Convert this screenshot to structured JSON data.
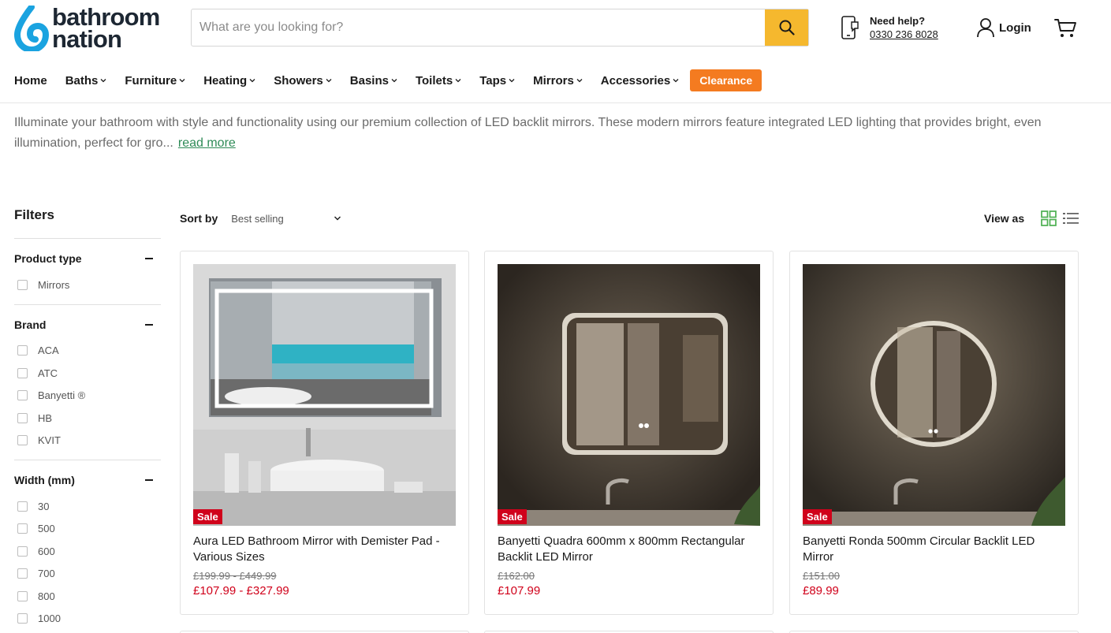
{
  "brand": {
    "line1": "bathroom",
    "line2": "nation",
    "logo_color": "#1aa3e0"
  },
  "search": {
    "placeholder": "What are you looking for?",
    "button_icon": "search-icon",
    "button_color": "#f5b82e"
  },
  "help": {
    "title": "Need help?",
    "phone": "0330 236 8028"
  },
  "account": {
    "login_label": "Login"
  },
  "nav": {
    "items": [
      {
        "label": "Home"
      },
      {
        "label": "Baths"
      },
      {
        "label": "Furniture"
      },
      {
        "label": "Heating"
      },
      {
        "label": "Showers"
      },
      {
        "label": "Basins"
      },
      {
        "label": "Toilets"
      },
      {
        "label": "Taps"
      },
      {
        "label": "Mirrors"
      },
      {
        "label": "Accessories"
      }
    ],
    "clearance": "Clearance",
    "clearance_color": "#f47b20"
  },
  "intro": {
    "text": "Illuminate your bathroom with style and functionality using our premium collection of LED backlit mirrors. These modern mirrors feature integrated LED lighting that provides bright, even illumination, perfect for gro...",
    "read_more": "read more"
  },
  "filters": {
    "title": "Filters",
    "groups": [
      {
        "label": "Product type",
        "options": [
          "Mirrors"
        ]
      },
      {
        "label": "Brand",
        "options": [
          "ACA",
          "ATC",
          "Banyetti ®",
          "HB",
          "KVIT"
        ]
      },
      {
        "label": "Width (mm)",
        "options": [
          "30",
          "500",
          "600",
          "700",
          "800",
          "1000"
        ]
      }
    ]
  },
  "toolbar": {
    "sort_label": "Sort by",
    "sort_value": "Best selling",
    "view_label": "View as"
  },
  "products": [
    {
      "badge": "Sale",
      "title": "Aura LED Bathroom Mirror with Demister Pad - Various Sizes",
      "was": "£199.99 - £449.99",
      "price": "£107.99 - £327.99"
    },
    {
      "badge": "Sale",
      "title": "Banyetti Quadra 600mm x 800mm Rectangular Backlit LED Mirror",
      "was": "£162.00",
      "price": "£107.99"
    },
    {
      "badge": "Sale",
      "title": "Banyetti Ronda 500mm Circular Backlit LED Mirror",
      "was": "£151.00",
      "price": "£89.99"
    }
  ],
  "colors": {
    "sale": "#d0021b",
    "link_green": "#2e8b57",
    "view_active": "#4caf50"
  }
}
